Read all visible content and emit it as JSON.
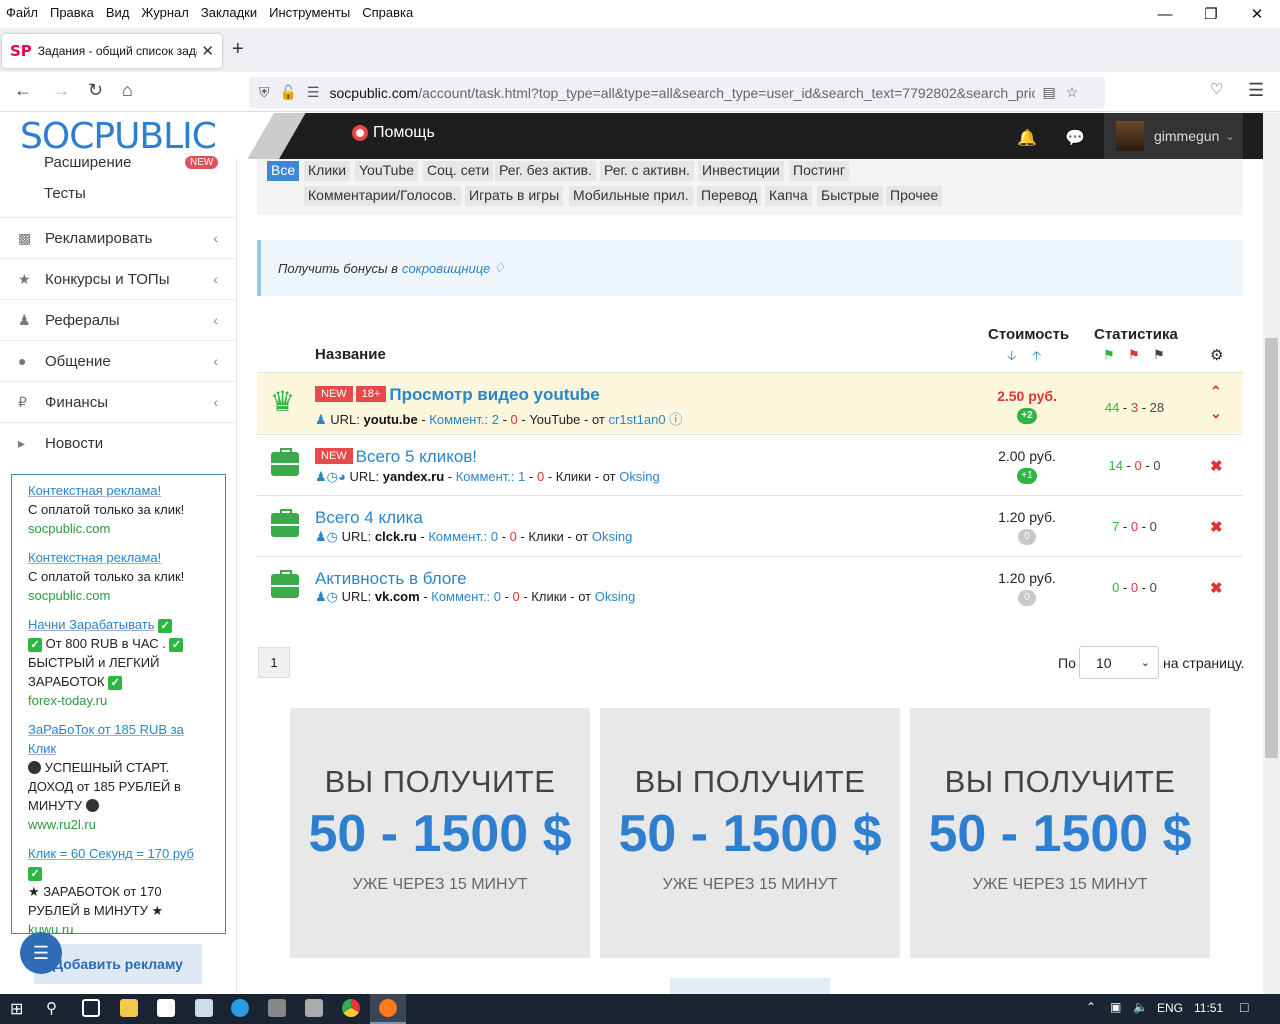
{
  "menu": [
    "Файл",
    "Правка",
    "Вид",
    "Журнал",
    "Закладки",
    "Инструменты",
    "Справка"
  ],
  "tab": {
    "favicon": "SP",
    "title": "Задания - общий список заданий"
  },
  "address": {
    "host": "socpublic.com",
    "path": "/account/task.html?top_type=all&type=all&search_type=user_id&search_text=7792802&search_pric"
  },
  "site": {
    "logo": "SOCPUBLIC",
    "help": "Помощь",
    "username": "gimmegun"
  },
  "sidebar": {
    "sub_items": [
      {
        "label": "Расширение",
        "badge": "NEW"
      },
      {
        "label": "Тесты"
      }
    ],
    "items": [
      {
        "label": "Рекламировать",
        "icon": "bar-chart-icon"
      },
      {
        "label": "Конкурсы и ТОПы",
        "icon": "trophy-icon"
      },
      {
        "label": "Рефералы",
        "icon": "users-icon"
      },
      {
        "label": "Общение",
        "icon": "comments-icon"
      },
      {
        "label": "Финансы",
        "icon": "ruble-icon"
      },
      {
        "label": "Новости",
        "icon": "megaphone-icon"
      }
    ],
    "ads": [
      {
        "title": "Контекстная реклама!",
        "body": "С оплатой только за клик!",
        "url": "socpublic.com"
      },
      {
        "title": "Контекстная реклама!",
        "body": "С оплатой только за клик!",
        "url": "socpublic.com"
      },
      {
        "title": "Начни Зарабатывать",
        "body1": "От 800 RUB в ЧАС .",
        "body2": "БЫСТРЫЙ и ЛЕГКИЙ ЗАРАБОТОК",
        "url": "forex-today.ru"
      },
      {
        "title": "ЗаРаБоТок от 185 RUB за Клик",
        "body1": "УСПЕШНЫЙ СТАРТ. ДОХОД от 185 РУБЛЕЙ в МИНУТУ",
        "url": "www.ru2l.ru"
      },
      {
        "title": "Клик = 60 Секунд = 170 руб",
        "body1": "★ ЗАРАБОТОК от 170 РУБЛЕЙ в МИНУТУ ★",
        "url": "kuwu.ru"
      }
    ],
    "add_ad": "Добавить рекламу"
  },
  "categories": {
    "row1": [
      "Все",
      "Клики",
      "YouTube",
      "Соц. сети",
      "Рег. без актив.",
      "Рег. с активн.",
      "Инвестиции",
      "Постинг"
    ],
    "row2": [
      "Комментарии/Голосов.",
      "Играть в игры",
      "Мобильные прил.",
      "Перевод",
      "Капча",
      "Быстрые",
      "Прочее"
    ]
  },
  "bonus": {
    "text": "Получить бонусы в",
    "link": "сокровищнице"
  },
  "table": {
    "col_name": "Название",
    "col_cost": "Стоимость",
    "col_stats": "Статистика"
  },
  "tasks": [
    {
      "tags": [
        "NEW",
        "18+"
      ],
      "title": "Просмотр видео youtube",
      "url_label": "URL:",
      "url": "youtu.be",
      "comm_label": "Коммент.:",
      "c1": "2",
      "c2": "0",
      "cat": "YouTube",
      "from": "от",
      "author": "cr1st1an0",
      "price": "2.50 руб.",
      "bonus": "+2",
      "s1": "44",
      "s2": "3",
      "s3": "28"
    },
    {
      "tags": [
        "NEW"
      ],
      "title": "Всего 5 кликов!",
      "url_label": "URL:",
      "url": "yandex.ru",
      "comm_label": "Коммент.:",
      "c1": "1",
      "c2": "0",
      "cat": "Клики",
      "from": "от",
      "author": "Oksing",
      "price": "2.00 руб.",
      "bonus": "+1",
      "s1": "14",
      "s2": "0",
      "s3": "0"
    },
    {
      "tags": [],
      "title": "Всего 4 клика",
      "url_label": "URL:",
      "url": "clck.ru",
      "comm_label": "Коммент.:",
      "c1": "0",
      "c2": "0",
      "cat": "Клики",
      "from": "от",
      "author": "Oksing",
      "price": "1.20 руб.",
      "bonus": "0",
      "s1": "7",
      "s2": "0",
      "s3": "0"
    },
    {
      "tags": [],
      "title": "Активность в блоге",
      "url_label": "URL:",
      "url": "vk.com",
      "comm_label": "Коммент.:",
      "c1": "0",
      "c2": "0",
      "cat": "Клики",
      "from": "от",
      "author": "Oksing",
      "price": "1.20 руб.",
      "bonus": "0",
      "s1": "0",
      "s2": "0",
      "s3": "0"
    }
  ],
  "pager": {
    "page": "1",
    "per_label": "По",
    "per_value": "10",
    "per_suffix": "на страницу."
  },
  "banner": {
    "line1": "ВЫ ПОЛУЧИТЕ",
    "line2": "50 - 1500 $",
    "line3": "УЖЕ ЧЕРЕЗ 15 МИНУТ"
  },
  "taskbar": {
    "lang": "ENG",
    "time": "11:51"
  }
}
